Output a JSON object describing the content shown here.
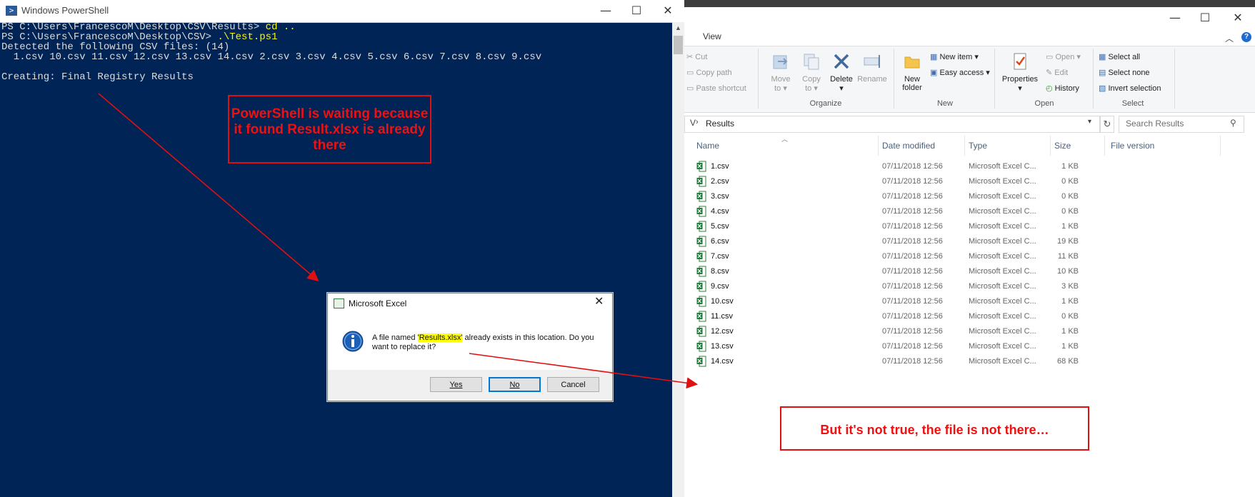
{
  "powershell": {
    "title": "Windows PowerShell",
    "lines": [
      {
        "prompt": "PS C:\\Users\\FrancescoM\\Desktop\\CSV\\Results> ",
        "cmd": "cd .."
      },
      {
        "prompt": "PS C:\\Users\\FrancescoM\\Desktop\\CSV> ",
        "cmd": ".\\Test.ps1"
      },
      {
        "text": "Detected the following CSV files: (14)"
      },
      {
        "text": "  1.csv 10.csv 11.csv 12.csv 13.csv 14.csv 2.csv 3.csv 4.csv 5.csv 6.csv 7.csv 8.csv 9.csv"
      },
      {
        "text": ""
      },
      {
        "text": "Creating: Final Registry Results"
      }
    ],
    "window_buttons": {
      "minimize": "—",
      "maximize": "☐",
      "close": "✕"
    }
  },
  "annotations": {
    "note1": "PowerShell is waiting because it found Result.xlsx is already there",
    "note2": "But it's not true, the file is not there…",
    "color": "#e01010"
  },
  "dialog": {
    "title": "Microsoft Excel",
    "close": "✕",
    "message_before": "A file named ",
    "message_highlight": "'Results.xlsx'",
    "message_after": " already exists in this location. Do you want to replace it?",
    "buttons": {
      "yes": "Yes",
      "no": "No",
      "cancel": "Cancel"
    }
  },
  "explorer": {
    "ribbon_tab": "View",
    "window_buttons": {
      "minimize": "—",
      "maximize": "☐",
      "close": "✕"
    },
    "ribbon": {
      "clipboard": {
        "cut": "Cut",
        "copy_path": "Copy path",
        "paste_shortcut": "Paste shortcut"
      },
      "organize": {
        "move_to": "Move",
        "move_to2": "to ▾",
        "copy_to": "Copy",
        "copy_to2": "to ▾",
        "delete": "Delete",
        "delete2": "▾",
        "rename": "Rename",
        "group": "Organize"
      },
      "new": {
        "new_item": "New item ▾",
        "easy_access": "Easy access ▾",
        "new_folder": "New",
        "new_folder2": "folder",
        "group": "New"
      },
      "open": {
        "properties": "Properties",
        "properties2": "▾",
        "open": "Open ▾",
        "edit": "Edit",
        "history": "History",
        "group": "Open"
      },
      "select": {
        "select_all": "Select all",
        "select_none": "Select none",
        "invert": "Invert selection",
        "group": "Select"
      }
    },
    "address": {
      "prefix": "V",
      "crumb": "Results"
    },
    "search_placeholder": "Search Results",
    "columns": {
      "name": "Name",
      "date": "Date modified",
      "type": "Type",
      "size": "Size",
      "version": "File version"
    },
    "files": [
      {
        "name": "1.csv",
        "date": "07/11/2018 12:56",
        "type": "Microsoft Excel C...",
        "size": "1 KB"
      },
      {
        "name": "2.csv",
        "date": "07/11/2018 12:56",
        "type": "Microsoft Excel C...",
        "size": "0 KB"
      },
      {
        "name": "3.csv",
        "date": "07/11/2018 12:56",
        "type": "Microsoft Excel C...",
        "size": "0 KB"
      },
      {
        "name": "4.csv",
        "date": "07/11/2018 12:56",
        "type": "Microsoft Excel C...",
        "size": "0 KB"
      },
      {
        "name": "5.csv",
        "date": "07/11/2018 12:56",
        "type": "Microsoft Excel C...",
        "size": "1 KB"
      },
      {
        "name": "6.csv",
        "date": "07/11/2018 12:56",
        "type": "Microsoft Excel C...",
        "size": "19 KB"
      },
      {
        "name": "7.csv",
        "date": "07/11/2018 12:56",
        "type": "Microsoft Excel C...",
        "size": "11 KB"
      },
      {
        "name": "8.csv",
        "date": "07/11/2018 12:56",
        "type": "Microsoft Excel C...",
        "size": "10 KB"
      },
      {
        "name": "9.csv",
        "date": "07/11/2018 12:56",
        "type": "Microsoft Excel C...",
        "size": "3 KB"
      },
      {
        "name": "10.csv",
        "date": "07/11/2018 12:56",
        "type": "Microsoft Excel C...",
        "size": "1 KB"
      },
      {
        "name": "11.csv",
        "date": "07/11/2018 12:56",
        "type": "Microsoft Excel C...",
        "size": "0 KB"
      },
      {
        "name": "12.csv",
        "date": "07/11/2018 12:56",
        "type": "Microsoft Excel C...",
        "size": "1 KB"
      },
      {
        "name": "13.csv",
        "date": "07/11/2018 12:56",
        "type": "Microsoft Excel C...",
        "size": "1 KB"
      },
      {
        "name": "14.csv",
        "date": "07/11/2018 12:56",
        "type": "Microsoft Excel C...",
        "size": "68 KB"
      }
    ]
  }
}
